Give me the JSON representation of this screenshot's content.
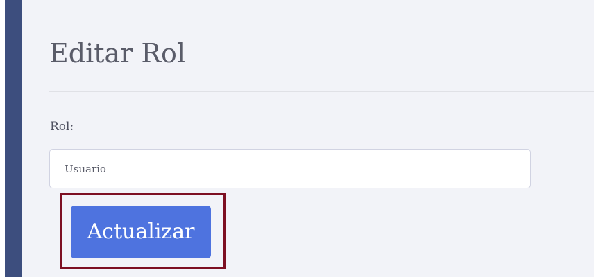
{
  "page": {
    "title": "Editar Rol"
  },
  "form": {
    "role_label": "Rol:",
    "role_value": "Usuario"
  },
  "actions": {
    "update_label": "Actualizar"
  },
  "colors": {
    "sidebar": "#3d4e7e",
    "background": "#f2f3f8",
    "primary_button": "#4e73df",
    "highlight_frame": "#7d0f22"
  }
}
